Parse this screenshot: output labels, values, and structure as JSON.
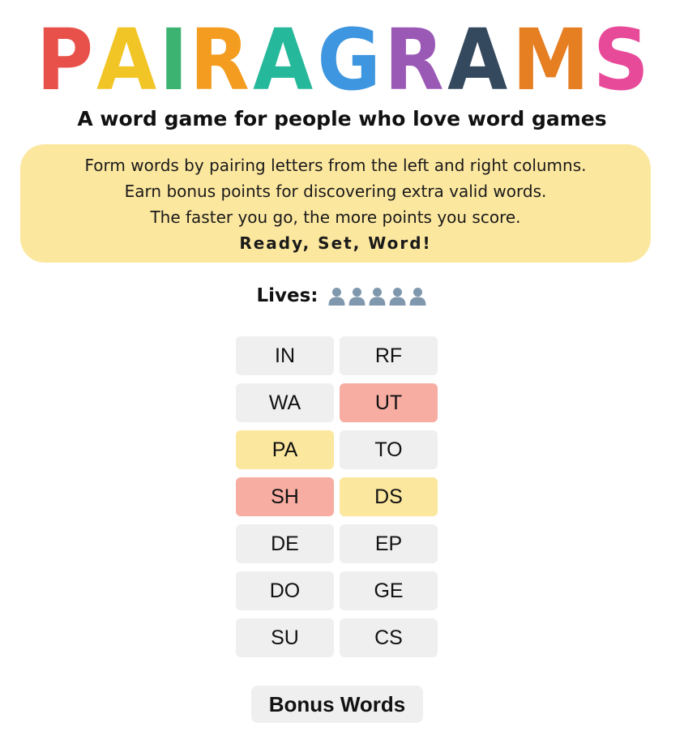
{
  "logo": {
    "letters": [
      {
        "char": "P",
        "color": "#e8514a"
      },
      {
        "char": "A",
        "color": "#f2c526"
      },
      {
        "char": "I",
        "color": "#3cb371"
      },
      {
        "char": "R",
        "color": "#f39c1f"
      },
      {
        "char": "A",
        "color": "#25b89a"
      },
      {
        "char": "G",
        "color": "#3d96df"
      },
      {
        "char": "R",
        "color": "#9b59b6"
      },
      {
        "char": "A",
        "color": "#34495e"
      },
      {
        "char": "M",
        "color": "#e67e22"
      },
      {
        "char": "S",
        "color": "#e84a9a"
      }
    ]
  },
  "tagline": "A word game for people who love word games",
  "instructions": {
    "line1": "Form words by pairing letters from the left and right columns.",
    "line2": "Earn bonus points for discovering extra valid words.",
    "line3": "The faster you go, the more points you score.",
    "ready": "Ready, Set, Word!",
    "background": "#fce79f"
  },
  "lives": {
    "label": "Lives:",
    "count": 5,
    "icon": "person-silhouette-icon",
    "icon_color": "#8098ad"
  },
  "board": {
    "left": [
      {
        "text": "IN",
        "state": "default"
      },
      {
        "text": "WA",
        "state": "default"
      },
      {
        "text": "PA",
        "state": "picked"
      },
      {
        "text": "SH",
        "state": "wrong"
      },
      {
        "text": "DE",
        "state": "default"
      },
      {
        "text": "DO",
        "state": "default"
      },
      {
        "text": "SU",
        "state": "default"
      }
    ],
    "right": [
      {
        "text": "RF",
        "state": "default"
      },
      {
        "text": "UT",
        "state": "wrong"
      },
      {
        "text": "TO",
        "state": "default"
      },
      {
        "text": "DS",
        "state": "picked"
      },
      {
        "text": "EP",
        "state": "default"
      },
      {
        "text": "GE",
        "state": "default"
      },
      {
        "text": "CS",
        "state": "default"
      }
    ],
    "colors": {
      "default": "#efefef",
      "wrong": "#f7ada2",
      "picked": "#fce79f"
    }
  },
  "bonus_button_label": "Bonus Words"
}
